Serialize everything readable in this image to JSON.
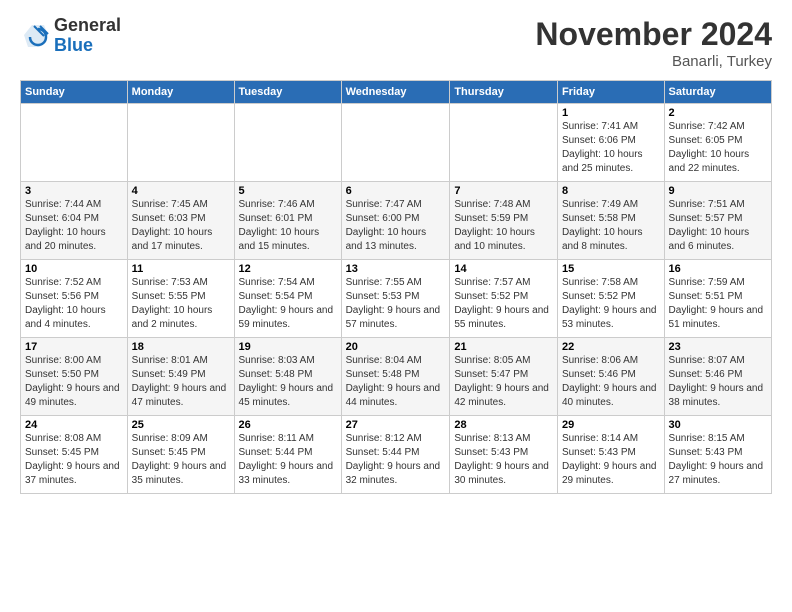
{
  "logo": {
    "general": "General",
    "blue": "Blue"
  },
  "header": {
    "month": "November 2024",
    "location": "Banarli, Turkey"
  },
  "weekdays": [
    "Sunday",
    "Monday",
    "Tuesday",
    "Wednesday",
    "Thursday",
    "Friday",
    "Saturday"
  ],
  "weeks": [
    [
      {
        "day": "",
        "info": ""
      },
      {
        "day": "",
        "info": ""
      },
      {
        "day": "",
        "info": ""
      },
      {
        "day": "",
        "info": ""
      },
      {
        "day": "",
        "info": ""
      },
      {
        "day": "1",
        "info": "Sunrise: 7:41 AM\nSunset: 6:06 PM\nDaylight: 10 hours\nand 25 minutes."
      },
      {
        "day": "2",
        "info": "Sunrise: 7:42 AM\nSunset: 6:05 PM\nDaylight: 10 hours\nand 22 minutes."
      }
    ],
    [
      {
        "day": "3",
        "info": "Sunrise: 7:44 AM\nSunset: 6:04 PM\nDaylight: 10 hours\nand 20 minutes."
      },
      {
        "day": "4",
        "info": "Sunrise: 7:45 AM\nSunset: 6:03 PM\nDaylight: 10 hours\nand 17 minutes."
      },
      {
        "day": "5",
        "info": "Sunrise: 7:46 AM\nSunset: 6:01 PM\nDaylight: 10 hours\nand 15 minutes."
      },
      {
        "day": "6",
        "info": "Sunrise: 7:47 AM\nSunset: 6:00 PM\nDaylight: 10 hours\nand 13 minutes."
      },
      {
        "day": "7",
        "info": "Sunrise: 7:48 AM\nSunset: 5:59 PM\nDaylight: 10 hours\nand 10 minutes."
      },
      {
        "day": "8",
        "info": "Sunrise: 7:49 AM\nSunset: 5:58 PM\nDaylight: 10 hours\nand 8 minutes."
      },
      {
        "day": "9",
        "info": "Sunrise: 7:51 AM\nSunset: 5:57 PM\nDaylight: 10 hours\nand 6 minutes."
      }
    ],
    [
      {
        "day": "10",
        "info": "Sunrise: 7:52 AM\nSunset: 5:56 PM\nDaylight: 10 hours\nand 4 minutes."
      },
      {
        "day": "11",
        "info": "Sunrise: 7:53 AM\nSunset: 5:55 PM\nDaylight: 10 hours\nand 2 minutes."
      },
      {
        "day": "12",
        "info": "Sunrise: 7:54 AM\nSunset: 5:54 PM\nDaylight: 9 hours\nand 59 minutes."
      },
      {
        "day": "13",
        "info": "Sunrise: 7:55 AM\nSunset: 5:53 PM\nDaylight: 9 hours\nand 57 minutes."
      },
      {
        "day": "14",
        "info": "Sunrise: 7:57 AM\nSunset: 5:52 PM\nDaylight: 9 hours\nand 55 minutes."
      },
      {
        "day": "15",
        "info": "Sunrise: 7:58 AM\nSunset: 5:52 PM\nDaylight: 9 hours\nand 53 minutes."
      },
      {
        "day": "16",
        "info": "Sunrise: 7:59 AM\nSunset: 5:51 PM\nDaylight: 9 hours\nand 51 minutes."
      }
    ],
    [
      {
        "day": "17",
        "info": "Sunrise: 8:00 AM\nSunset: 5:50 PM\nDaylight: 9 hours\nand 49 minutes."
      },
      {
        "day": "18",
        "info": "Sunrise: 8:01 AM\nSunset: 5:49 PM\nDaylight: 9 hours\nand 47 minutes."
      },
      {
        "day": "19",
        "info": "Sunrise: 8:03 AM\nSunset: 5:48 PM\nDaylight: 9 hours\nand 45 minutes."
      },
      {
        "day": "20",
        "info": "Sunrise: 8:04 AM\nSunset: 5:48 PM\nDaylight: 9 hours\nand 44 minutes."
      },
      {
        "day": "21",
        "info": "Sunrise: 8:05 AM\nSunset: 5:47 PM\nDaylight: 9 hours\nand 42 minutes."
      },
      {
        "day": "22",
        "info": "Sunrise: 8:06 AM\nSunset: 5:46 PM\nDaylight: 9 hours\nand 40 minutes."
      },
      {
        "day": "23",
        "info": "Sunrise: 8:07 AM\nSunset: 5:46 PM\nDaylight: 9 hours\nand 38 minutes."
      }
    ],
    [
      {
        "day": "24",
        "info": "Sunrise: 8:08 AM\nSunset: 5:45 PM\nDaylight: 9 hours\nand 37 minutes."
      },
      {
        "day": "25",
        "info": "Sunrise: 8:09 AM\nSunset: 5:45 PM\nDaylight: 9 hours\nand 35 minutes."
      },
      {
        "day": "26",
        "info": "Sunrise: 8:11 AM\nSunset: 5:44 PM\nDaylight: 9 hours\nand 33 minutes."
      },
      {
        "day": "27",
        "info": "Sunrise: 8:12 AM\nSunset: 5:44 PM\nDaylight: 9 hours\nand 32 minutes."
      },
      {
        "day": "28",
        "info": "Sunrise: 8:13 AM\nSunset: 5:43 PM\nDaylight: 9 hours\nand 30 minutes."
      },
      {
        "day": "29",
        "info": "Sunrise: 8:14 AM\nSunset: 5:43 PM\nDaylight: 9 hours\nand 29 minutes."
      },
      {
        "day": "30",
        "info": "Sunrise: 8:15 AM\nSunset: 5:43 PM\nDaylight: 9 hours\nand 27 minutes."
      }
    ]
  ]
}
